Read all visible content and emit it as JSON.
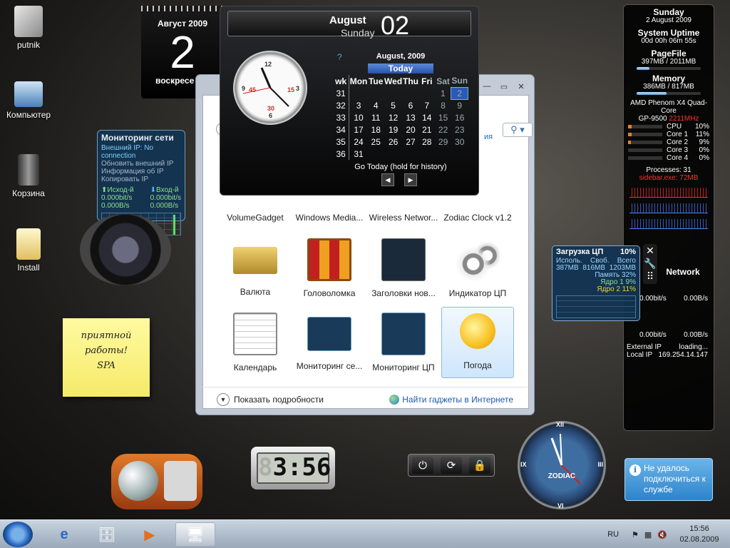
{
  "desktop": {
    "icons": [
      {
        "label": "putnik",
        "icon": "user-folder-icon"
      },
      {
        "label": "Компьютер",
        "icon": "computer-icon"
      },
      {
        "label": "Корзина",
        "icon": "recycle-bin-icon"
      },
      {
        "label": "Install",
        "icon": "folder-icon"
      }
    ]
  },
  "flip_calendar": {
    "month_year": "Август 2009",
    "day": "2",
    "weekday": "воскресе"
  },
  "network_monitor": {
    "title": "Мониторинг сети",
    "external_ip": "Внешний IP: No connection",
    "lines": [
      "Обновить внешний IP",
      "Информация об IP",
      "Копировать IP"
    ],
    "upload_label": "Исход-й",
    "download_label": "Вход-й",
    "up_bits": "0.000bit/s",
    "down_bits": "0.000bit/s",
    "up_bytes": "0.000B/s",
    "down_bytes": "0.000B/s"
  },
  "sticky_note": {
    "lines": [
      "приятной",
      "работы!",
      "SPA"
    ]
  },
  "digital_clock": {
    "time": "3:56",
    "faded_digit": "8"
  },
  "big_calendar": {
    "month": "August",
    "weekday": "Sunday",
    "day": "02",
    "help": "?",
    "cal_title": "August, 2009",
    "today_label": "Today",
    "headers": [
      "wk",
      "Mon",
      "Tue",
      "Wed",
      "Thu",
      "Fri",
      "Sat",
      "Sun"
    ],
    "rows": [
      [
        "31",
        "",
        "",
        "",
        "",
        "",
        "1",
        "2"
      ],
      [
        "32",
        "3",
        "4",
        "5",
        "6",
        "7",
        "8",
        "9"
      ],
      [
        "33",
        "10",
        "11",
        "12",
        "13",
        "14",
        "15",
        "16"
      ],
      [
        "34",
        "17",
        "18",
        "19",
        "20",
        "21",
        "22",
        "23"
      ],
      [
        "35",
        "24",
        "25",
        "26",
        "27",
        "28",
        "29",
        "30"
      ],
      [
        "36",
        "31",
        "",
        "",
        "",
        "",
        "",
        ""
      ]
    ],
    "footer": "Go Today (hold for history)",
    "clock_numbers": [
      "12",
      "3",
      "6",
      "9",
      "15",
      "30",
      "45"
    ]
  },
  "gallery": {
    "row1": [
      "VolumeGadget",
      "Windows Media...",
      "Wireless Networ...",
      "Zodiac Clock v1.2"
    ],
    "row2": [
      "Валюта",
      "Головоломка",
      "Заголовки нов...",
      "Индикатор ЦП"
    ],
    "row3": [
      "Календарь",
      "Мониторинг се...",
      "Мониторинг ЦП",
      "Погода"
    ],
    "show_details": "Показать подробности",
    "online": "Найти гаджеты в Интернете",
    "selected": "Погода",
    "side_link": "ия"
  },
  "sidebar": {
    "date_day": "Sunday",
    "date_full": "2 August 2009",
    "uptime_label": "System Uptime",
    "uptime": "00d 00h 06m 55s",
    "pagefile_label": "PageFile",
    "pagefile": "397MB / 2011MB",
    "pagefile_pct": 0.2,
    "memory_label": "Memory",
    "memory": "386MB / 817MB",
    "memory_pct": 0.47,
    "cpu_name": "AMD Phenom X4 Quad-Core",
    "gpu_prefix": "GP-9500",
    "gpu_mhz": "2211MHz",
    "cores": [
      {
        "name": "CPU",
        "value": "10%",
        "pct": 0.1
      },
      {
        "name": "Core 1",
        "value": "11%",
        "pct": 0.11
      },
      {
        "name": "Core 2",
        "value": "9%",
        "pct": 0.09
      },
      {
        "name": "Core 3",
        "value": "0%",
        "pct": 0.0
      },
      {
        "name": "Core 4",
        "value": "0%",
        "pct": 0.0
      }
    ],
    "processes": "Processes: 31",
    "sidebar_exe": "sidebar.exe: 72MB",
    "network_label": "Network",
    "net_left1": "0.00bit/s",
    "net_right1": "0.00B/s",
    "net_left2": "0.00bit/s",
    "net_right2": "0.00B/s",
    "external_ip_label": "External IP",
    "external_ip": "loading...",
    "local_ip_label": "Local IP",
    "local_ip": "169.254.14.147"
  },
  "cpu_gadget": {
    "title": "Загрузка ЦП",
    "total": "10%",
    "cols": [
      "Исполь.",
      "Своб.",
      "Всего"
    ],
    "vals": [
      "387MB",
      "816MB",
      "1203MB"
    ],
    "memory_label": "Память",
    "memory": "32%",
    "core1_label": "Ядро 1",
    "core1": "9%",
    "core2_label": "Ядро 2",
    "core2": "11%"
  },
  "zodiac_clock": {
    "label": "ZODIAC",
    "numerals": [
      "XII",
      "III",
      "VI",
      "IX"
    ]
  },
  "notification": {
    "text": "Не удалось подключиться к службе"
  },
  "taskbar": {
    "lang": "RU",
    "time": "15:56",
    "date": "02.08.2009"
  },
  "colors": {
    "accent": "#2a5ab8",
    "gpu_red": "#ff3030",
    "graph_green": "#5fe05f"
  }
}
